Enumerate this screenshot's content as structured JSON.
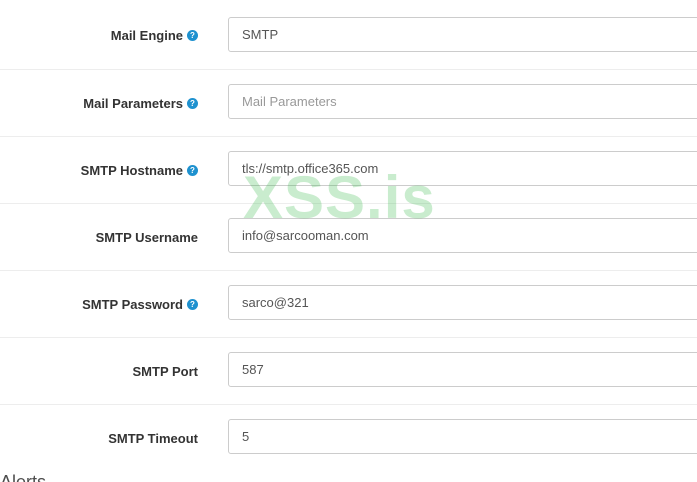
{
  "fields": [
    {
      "label": "Mail Engine",
      "help": true,
      "value": "SMTP",
      "placeholder": ""
    },
    {
      "label": "Mail Parameters",
      "help": true,
      "value": "",
      "placeholder": "Mail Parameters"
    },
    {
      "label": "SMTP Hostname",
      "help": true,
      "value": "tls://smtp.office365.com",
      "placeholder": ""
    },
    {
      "label": "SMTP Username",
      "help": false,
      "value": "info@sarcooman.com",
      "placeholder": ""
    },
    {
      "label": "SMTP Password",
      "help": true,
      "value": "sarco@321",
      "placeholder": ""
    },
    {
      "label": "SMTP Port",
      "help": false,
      "value": "587",
      "placeholder": ""
    },
    {
      "label": "SMTP Timeout",
      "help": false,
      "value": "5",
      "placeholder": ""
    }
  ],
  "help_icon_glyph": "?",
  "watermark": "XSS.is",
  "next_section": "Alerts",
  "colors": {
    "help_icon": "#1e91cf",
    "watermark": "#3cb950"
  }
}
